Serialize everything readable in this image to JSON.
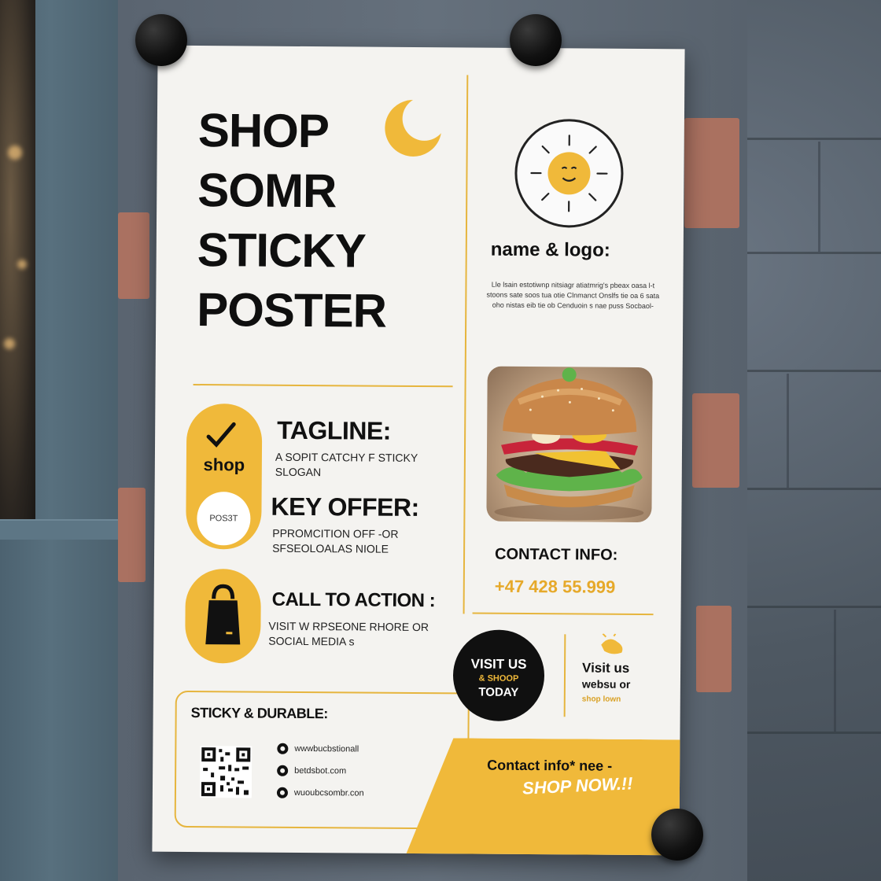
{
  "poster": {
    "headline": [
      "SHOP",
      "SOMR",
      "STICKY",
      "POSTER"
    ],
    "pill_label": "shop",
    "pill_badge": "POS3T",
    "tagline_head": "TAGLINE:",
    "tagline_body": "A SOPIT CATCHY F STICKY SLOGAN",
    "offer_head": "KEY OFFER:",
    "offer_body": "PPROMCITION OFF -OR SFSEOLOALAS NIOLE",
    "cta_head": "CALL TO ACTION :",
    "cta_body": "VISIT W RPSEONE RHORE OR SOCIAL MEDIA s",
    "sticky_head": "STICKY & DURABLE:",
    "social": [
      "wwwbucbstionall",
      "betdsbot.com",
      "wuoubcsombr.con"
    ],
    "name_logo": "name & logo:",
    "fine_print": "Lle lsain estotiwnp nitsiagr atiatmrig's pbeax oasa l-t stoons sate soos tua otie Clnmanct Onslfs tie oa 6 sata oho nistas eib tie ob Cenduoin s nae puss Socbaol-",
    "contact_head": "CONTACT INFO:",
    "phone": "+47 428 55.999",
    "visit_circle": [
      "VISIT US",
      "& SHOOP",
      "TODAY"
    ],
    "visit_web": [
      "Visit us",
      "websu or",
      "shop lown"
    ],
    "contact_now": "Contact info* nee -",
    "shop_now": "SHOP NOW.!!"
  },
  "colors": {
    "accent": "#f0b93a",
    "ink": "#111111",
    "paper": "#f4f3f0"
  },
  "icons": [
    "moon-icon",
    "checkmark-icon",
    "shopping-bag-icon",
    "sun-face-icon",
    "qr-code-icon",
    "social-dot-icon",
    "splash-icon"
  ]
}
